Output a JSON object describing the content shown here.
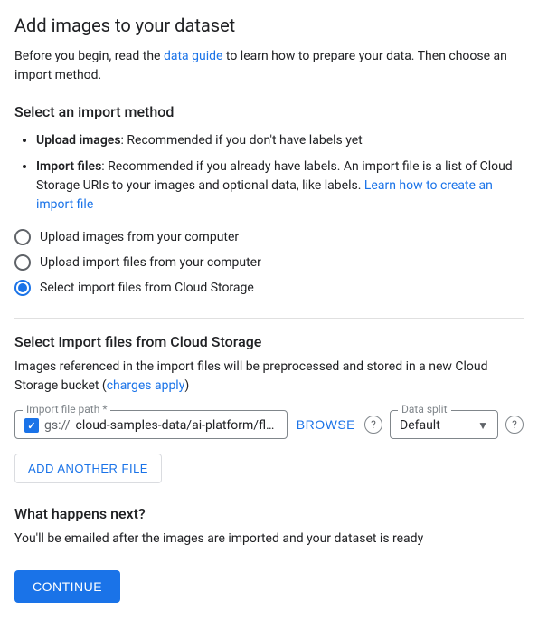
{
  "page": {
    "title": "Add images to your dataset",
    "intro": {
      "text_before_link": "Before you begin, read the ",
      "link_text": "data guide",
      "text_after_link": " to learn how to prepare your data. Then choose an import method."
    },
    "select_method_section": {
      "title": "Select an import method",
      "bullets": [
        {
          "label": "Upload images",
          "text": ": Recommended if you don't have labels yet"
        },
        {
          "label": "Import files",
          "text": ": Recommended if you already have labels. An import file is a list of Cloud Storage URIs to your images and optional data, like labels. ",
          "link_text": "Learn how to create an import file",
          "link_href": "#"
        }
      ],
      "radio_options": [
        {
          "id": "radio-upload-images",
          "label": "Upload images from your computer",
          "selected": false
        },
        {
          "id": "radio-upload-import",
          "label": "Upload import files from your computer",
          "selected": false
        },
        {
          "id": "radio-cloud-storage",
          "label": "Select import files from Cloud Storage",
          "selected": true
        }
      ]
    },
    "cloud_section": {
      "title": "Select import files from Cloud Storage",
      "description_before_link": "Images referenced in the import files will be preprocessed and stored in a new Cloud Storage bucket (",
      "description_link_text": "charges apply",
      "description_after_link": ")",
      "file_path_label": "Import file path *",
      "file_path_prefix": "gs://",
      "file_path_value": "cloud-samples-data/ai-platform/flowers/flow",
      "browse_button": "BROWSE",
      "data_split_label": "Data split",
      "data_split_value": "Default"
    },
    "add_file_button": "ADD ANOTHER FILE",
    "what_next": {
      "title": "What happens next?",
      "text": "You'll be emailed after the images are imported and your dataset is ready"
    },
    "continue_button": "CONTINUE"
  }
}
